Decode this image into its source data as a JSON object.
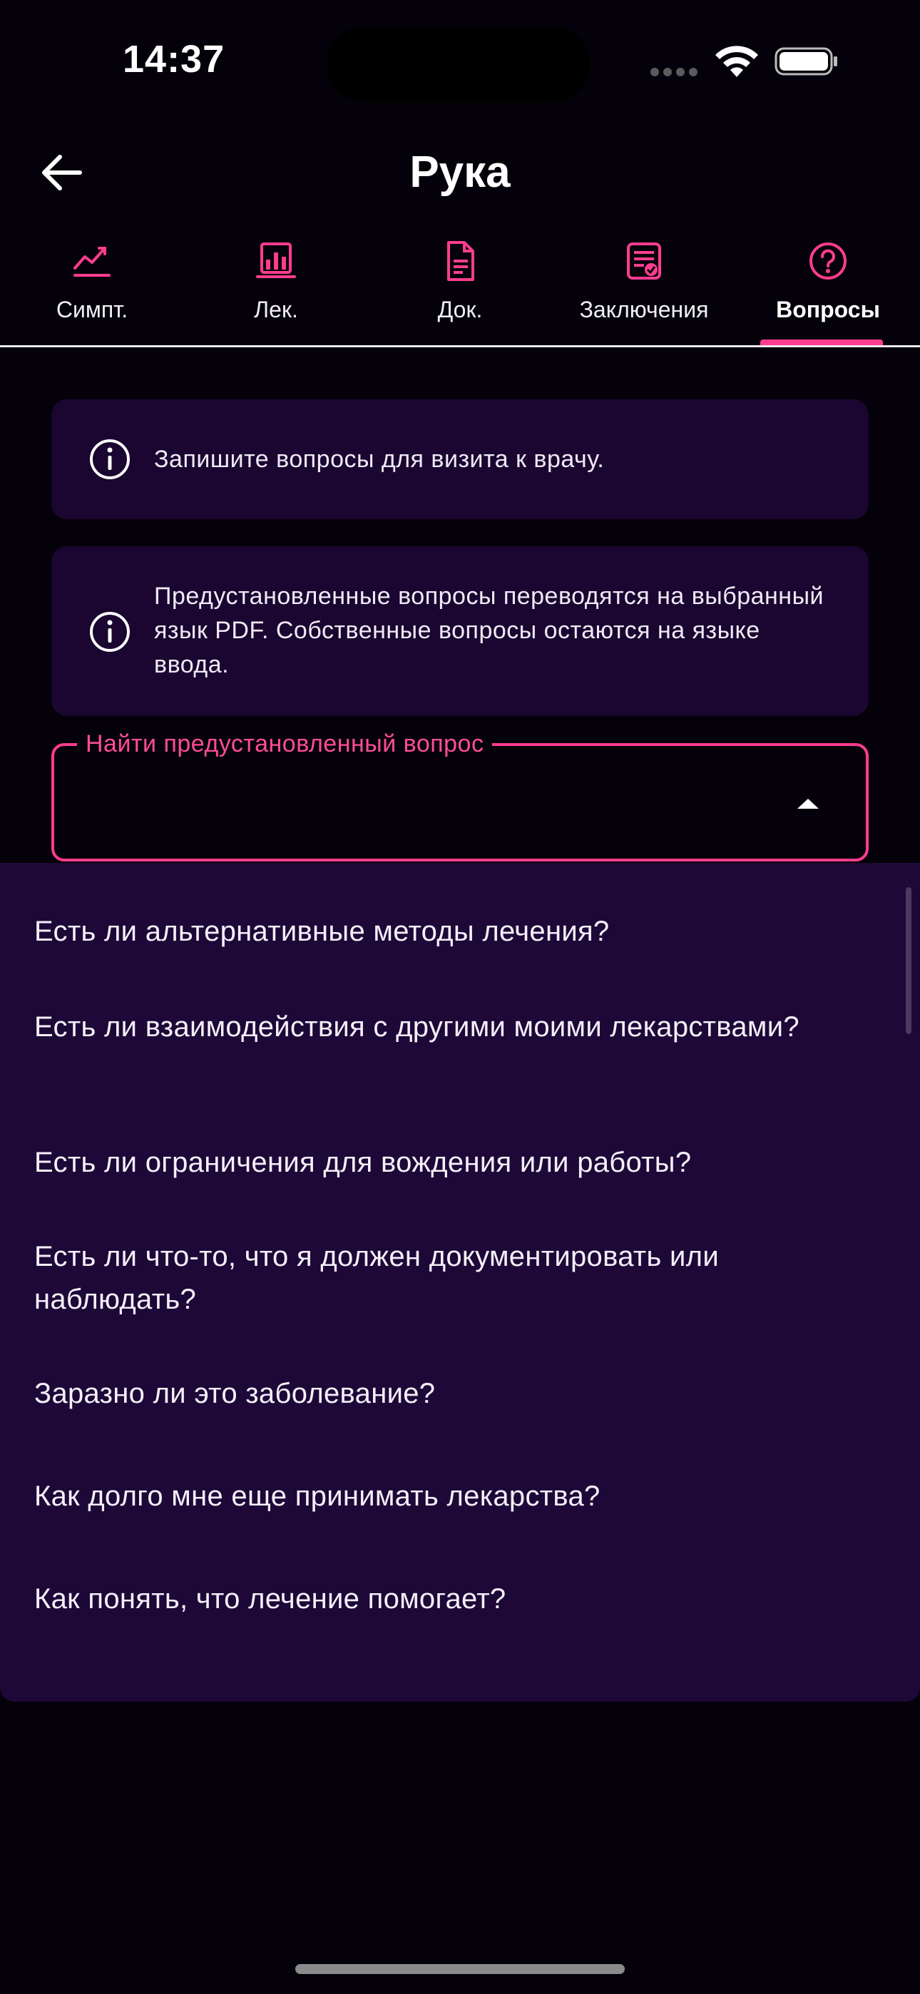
{
  "status_bar": {
    "time": "14:37"
  },
  "header": {
    "title": "Рука"
  },
  "tabs": [
    {
      "label": "Симпт.",
      "icon": "trend-chart-icon"
    },
    {
      "label": "Лек.",
      "icon": "bar-chart-icon"
    },
    {
      "label": "Док.",
      "icon": "document-icon"
    },
    {
      "label": "Заключения",
      "icon": "report-icon"
    },
    {
      "label": "Вопросы",
      "icon": "question-icon",
      "active": true
    }
  ],
  "info_cards": [
    {
      "text": "Запишите вопросы для визита к врачу."
    },
    {
      "text": "Предустановленные вопросы переводятся на выбранный язык PDF. Собственные вопросы остаются на языке ввода."
    }
  ],
  "search": {
    "label": "Найти предустановленный вопрос",
    "value": ""
  },
  "options": [
    "Есть ли альтернативные методы лечения?",
    "Есть ли взаимодействия с другими моими лекарствами?",
    "Есть ли ограничения для вождения или работы?",
    "Есть ли что-то, что я должен документировать или наблюдать?",
    "Заразно ли это заболевание?",
    "Как долго мне еще принимать лекарства?",
    "Как понять, что лечение помогает?"
  ],
  "colors": {
    "accent": "#ff3d8f",
    "background": "#05010a",
    "card": "#1a0630",
    "dropdown": "#1e0838"
  }
}
